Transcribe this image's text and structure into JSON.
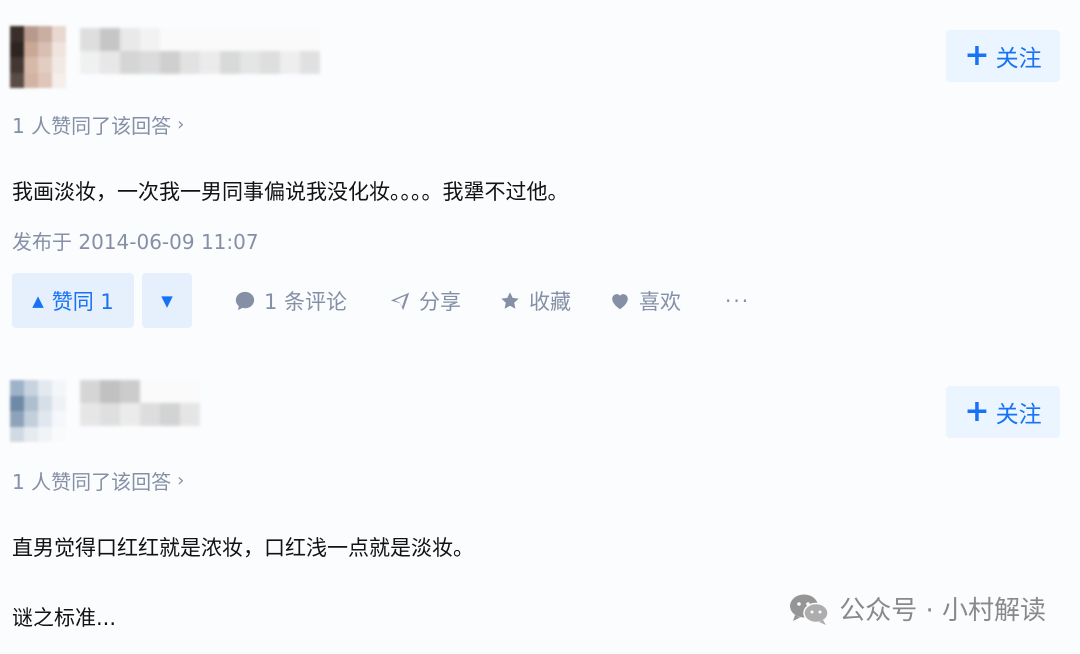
{
  "answers": [
    {
      "follow_label": "关注",
      "agree_text": "1 人赞同了该回答",
      "content": "我画淡妆，一次我一男同事偏说我没化妆。。。。我犟不过他。",
      "published": "发布于 2014-06-09 11:07",
      "actions": {
        "vote_up": "赞同 1",
        "comments": "1 条评论",
        "share": "分享",
        "collect": "收藏",
        "like": "喜欢",
        "more": "···"
      }
    },
    {
      "follow_label": "关注",
      "agree_text": "1 人赞同了该回答",
      "content_line1": "直男觉得口红红就是浓妆，口红浅一点就是淡妆。",
      "content_line2": "谜之标准..."
    }
  ],
  "watermark": {
    "text": "公众号 · 小村解读",
    "icon": "wechat-icon"
  },
  "colors": {
    "accent": "#1772f6",
    "accent_bg": "#ebf5ff",
    "muted": "#8590a6"
  }
}
